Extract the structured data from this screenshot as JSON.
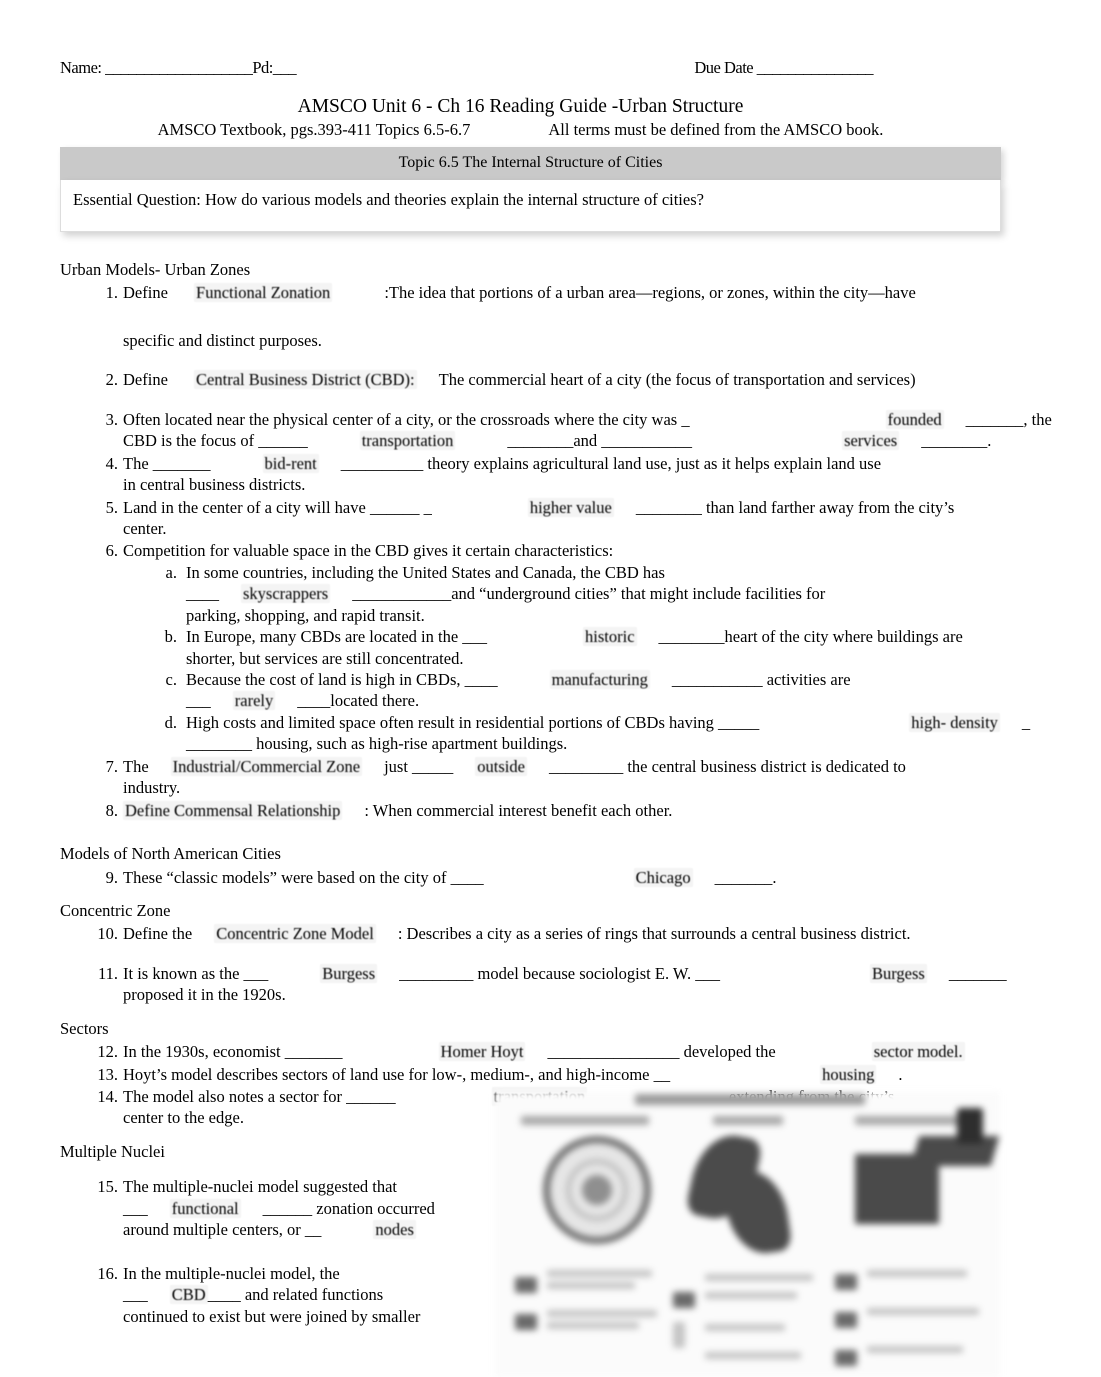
{
  "header": {
    "name_label": "Name: ___________________Pd:___",
    "due_date_label": "Due Date _______________"
  },
  "title": {
    "main": "AMSCO Unit 6 - Ch 16 Reading Guide -Urban Structure",
    "sub_left": "AMSCO Textbook, pgs.393-411 Topics 6.5-6.7",
    "sub_right": "All terms must be defined from the AMSCO book."
  },
  "topic_banner": "Topic 6.5 The Internal Structure of Cities",
  "essential_question": "Essential Question: How do various models and theories explain the internal structure of cities?",
  "sections": {
    "urban_models_heading": "Urban Models- Urban Zones",
    "north_american_heading": "Models of North American Cities",
    "concentric_heading": "Concentric Zone",
    "sectors_heading": "Sectors",
    "multiple_nuclei_heading": "Multiple Nuclei"
  },
  "questions": {
    "q1": {
      "num": "1.",
      "pre": "Define",
      "answer": "Functional Zonation",
      "post": ":The idea that portions of a urban area—regions, or zones, within the city—have",
      "line2": "specific and distinct purposes."
    },
    "q2": {
      "num": "2.",
      "pre": "Define",
      "answer": "Central Business District (CBD):",
      "post": "The commercial heart of a city (the focus of transportation and services)"
    },
    "q3": {
      "num": "3.",
      "part1": "Often located near the physical center of a city, or the crossroads where the city was _",
      "answer1": "founded",
      "blank1": "_______, the",
      "part2": "CBD is the focus of ______",
      "answer2": "transportation",
      "blank2": "________and ___________",
      "answer3": "services",
      "blank3": "________."
    },
    "q4": {
      "num": "4.",
      "part1": "The _______",
      "answer1": "bid-rent",
      "part2": "__________ theory explains agricultural land use, just as it helps explain land use",
      "line2": "in central business districts."
    },
    "q5": {
      "num": "5.",
      "part1": "Land in the center of a city will have ______ _",
      "answer1": "higher value",
      "part2": "________ than land farther away from the city’s",
      "line2": "center."
    },
    "q6": {
      "num": "6.",
      "text": "Competition for valuable space in the CBD gives it certain characteristics:",
      "a": {
        "num": "a.",
        "line1": "In some countries, including the United States and Canada, the CBD has",
        "line2_pre": "____",
        "line2_answer": "skyscrappers",
        "line2_post": "____________and “underground cities” that might include facilities for",
        "line3": "parking, shopping, and rapid transit."
      },
      "b": {
        "num": "b.",
        "line1_pre": "In Europe, many CBDs are located in the ___",
        "line1_answer": "historic",
        "line1_post": "________heart of the city where buildings are",
        "line2": "shorter, but services are still concentrated."
      },
      "c": {
        "num": "c.",
        "line1_pre": "Because the cost of land is high in CBDs, ____",
        "line1_answer": "manufacturing",
        "line1_post": "___________ activities are",
        "line2_pre": "___",
        "line2_answer": "rarely",
        "line2_post": "____located there."
      },
      "d": {
        "num": "d.",
        "line1_pre": "High costs and limited space often result in residential portions of CBDs having _____",
        "line1_answer": "high- density",
        "line1_tail": "_",
        "line2": "________ housing, such as high-rise apartment buildings."
      }
    },
    "q7": {
      "num": "7.",
      "pre": "The",
      "answer1": "Industrial/Commercial Zone",
      "mid1": "just _____",
      "answer2": "outside",
      "post": "_________ the central business district is dedicated to",
      "line2": "industry."
    },
    "q8": {
      "num": "8.",
      "answer": "Define Commensal Relationship",
      "post": ": When commercial interest benefit each other."
    },
    "q9": {
      "num": "9.",
      "pre": "These “classic models” were based on the city of ____",
      "answer": "Chicago",
      "post": "_______."
    },
    "q10": {
      "num": "10.",
      "pre": "Define the",
      "answer": "Concentric Zone Model",
      "post": ": Describes a city as a series of rings that surrounds a central business district."
    },
    "q11": {
      "num": "11.",
      "pre": "It is known as the ___",
      "answer1": "Burgess",
      "mid": "_________ model because sociologist E. W. ___",
      "answer2": "Burgess",
      "post": "_______",
      "line2": "proposed it in the 1920s."
    },
    "q12": {
      "num": "12.",
      "pre": "In the 1930s, economist _______",
      "answer1": "Homer Hoyt",
      "mid": "________________ developed the",
      "answer2": "sector model."
    },
    "q13": {
      "num": "13.",
      "pre": "Hoyt’s model describes sectors of land use for low-, medium-, and high-income __",
      "answer": "housing",
      "post": "."
    },
    "q14": {
      "num": "14.",
      "pre": "The model also notes a sector for ______",
      "answer": "transportation",
      "post": "______________ extending from the city’s",
      "line2": "center to the edge."
    },
    "q15": {
      "num": "15.",
      "line1": "The multiple-nuclei model suggested that",
      "line2_pre": "___",
      "line2_answer": "functional",
      "line2_post": "______ zonation occurred",
      "line3_pre": "around multiple centers, or __",
      "line3_answer": "nodes"
    },
    "q16": {
      "num": "16.",
      "line1": "In the multiple-nuclei model, the",
      "line2_pre": "___",
      "line2_answer": "CBD",
      "line2_post": "____ and related functions",
      "line3": "continued to exist but were joined by smaller"
    }
  },
  "figure": {
    "alt": "blurred diagram of three classic urban models: concentric zone, sector, and multiple nuclei"
  }
}
